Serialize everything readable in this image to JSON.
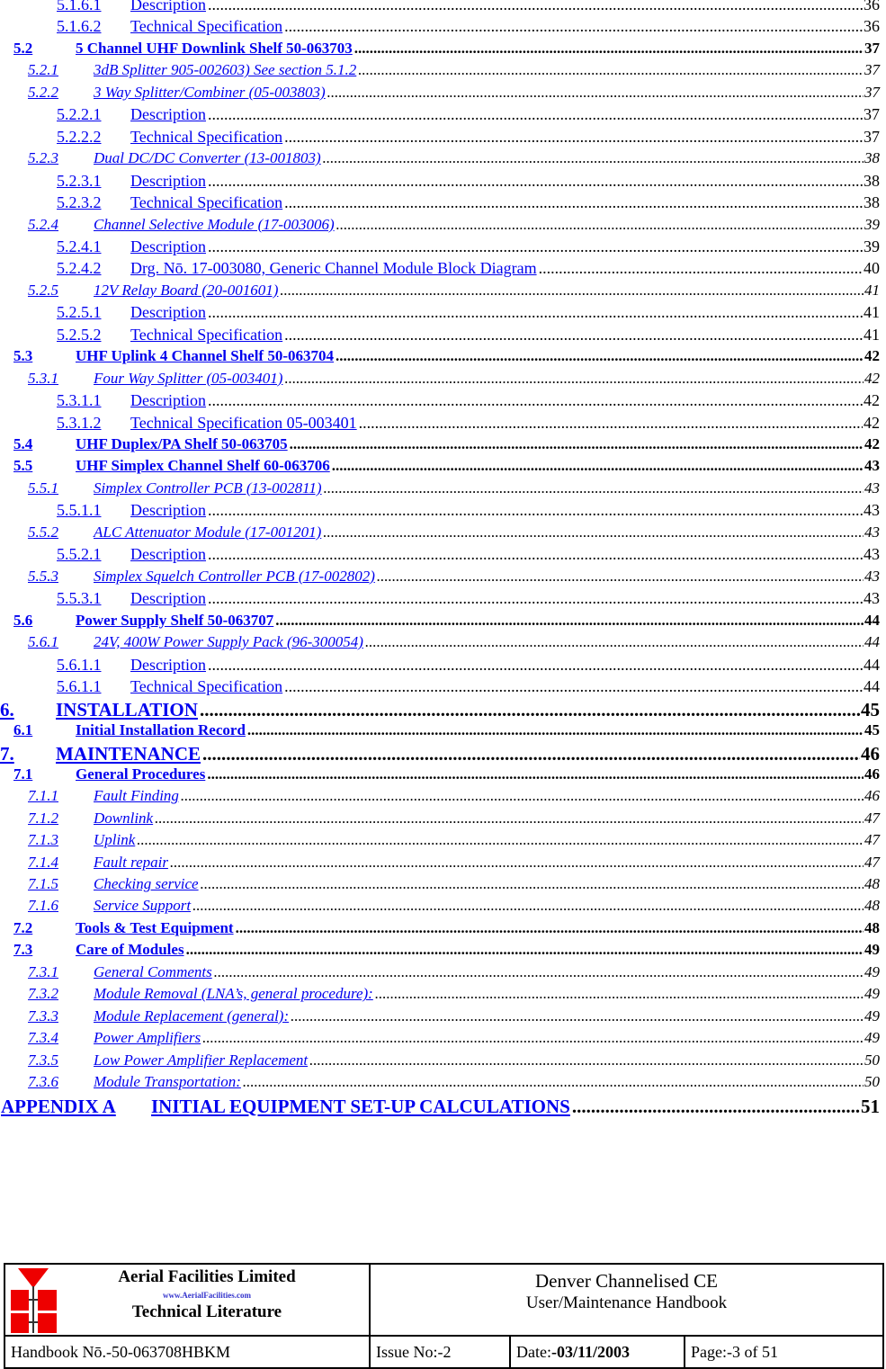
{
  "toc": [
    {
      "level": "l4",
      "num": "5.1.6.1",
      "title": "Description",
      "page": "36"
    },
    {
      "level": "l4",
      "num": "5.1.6.2",
      "title": "Technical Specification",
      "page": "36"
    },
    {
      "level": "l2",
      "num": "5.2",
      "title": "5 Channel UHF Downlink Shelf 50-063703",
      "page": "37"
    },
    {
      "level": "l3",
      "num": "5.2.1",
      "title": "3dB Splitter 905-002603) See section 5.1.2",
      "page": "37"
    },
    {
      "level": "l3",
      "num": "5.2.2",
      "title": "3 Way Splitter/Combiner (05-003803)",
      "page": "37"
    },
    {
      "level": "l4",
      "num": "5.2.2.1",
      "title": "Description",
      "page": "37"
    },
    {
      "level": "l4",
      "num": "5.2.2.2",
      "title": "Technical Specification",
      "page": "37"
    },
    {
      "level": "l3",
      "num": "5.2.3",
      "title": "Dual DC/DC Converter (13-001803)",
      "page": "38"
    },
    {
      "level": "l4",
      "num": "5.2.3.1",
      "title": "Description",
      "page": "38"
    },
    {
      "level": "l4",
      "num": "5.2.3.2",
      "title": "Technical Specification",
      "page": "38"
    },
    {
      "level": "l3",
      "num": "5.2.4",
      "title": "Channel Selective Module (17-003006)",
      "page": "39"
    },
    {
      "level": "l4",
      "num": "5.2.4.1",
      "title": "Description",
      "page": "39"
    },
    {
      "level": "l4",
      "num": "5.2.4.2",
      "title": "Drg. Nō. 17-003080, Generic Channel Module Block Diagram",
      "page": "40"
    },
    {
      "level": "l3",
      "num": "5.2.5",
      "title": "12V Relay Board (20-001601)",
      "page": "41"
    },
    {
      "level": "l4",
      "num": "5.2.5.1",
      "title": "Description",
      "page": "41"
    },
    {
      "level": "l4",
      "num": "5.2.5.2",
      "title": "Technical Specification",
      "page": "41"
    },
    {
      "level": "l2",
      "num": "5.3",
      "title": "UHF Uplink 4 Channel Shelf 50-063704",
      "page": "42"
    },
    {
      "level": "l3",
      "num": "5.3.1",
      "title": "Four Way Splitter (05-003401)",
      "page": "42"
    },
    {
      "level": "l4",
      "num": "5.3.1.1",
      "title": "Description",
      "page": "42"
    },
    {
      "level": "l4",
      "num": "5.3.1.2",
      "title": "Technical Specification 05-003401",
      "page": "42"
    },
    {
      "level": "l2",
      "num": "5.4",
      "title": "UHF Duplex/PA Shelf 50-063705",
      "page": "42"
    },
    {
      "level": "l2",
      "num": "5.5",
      "title": "UHF Simplex Channel Shelf 60-063706",
      "page": "43"
    },
    {
      "level": "l3",
      "num": "5.5.1",
      "title": "Simplex Controller PCB (13-002811)",
      "page": "43"
    },
    {
      "level": "l4",
      "num": "5.5.1.1",
      "title": "Description",
      "page": "43"
    },
    {
      "level": "l3",
      "num": "5.5.2",
      "title": "ALC Attenuator Module (17-001201)",
      "page": "43"
    },
    {
      "level": "l4",
      "num": "5.5.2.1",
      "title": "Description",
      "page": "43"
    },
    {
      "level": "l3",
      "num": "5.5.3",
      "title": "Simplex Squelch Controller PCB (17-002802)",
      "page": "43"
    },
    {
      "level": "l4",
      "num": "5.5.3.1",
      "title": "Description",
      "page": "43"
    },
    {
      "level": "l2",
      "num": "5.6",
      "title": "Power Supply Shelf 50-063707",
      "page": "44"
    },
    {
      "level": "l3",
      "num": "5.6.1",
      "title": "24V, 400W Power Supply Pack (96-300054)",
      "page": "44"
    },
    {
      "level": "l4",
      "num": "5.6.1.1",
      "title": "Description",
      "page": "44"
    },
    {
      "level": "l4",
      "num": "5.6.1.1",
      "title": "Technical Specification",
      "page": "44"
    },
    {
      "level": "l1",
      "num": "6.",
      "title": "INSTALLATION",
      "page": "45"
    },
    {
      "level": "l2",
      "num": "6.1",
      "title": "Initial Installation Record",
      "page": "45"
    },
    {
      "level": "l1",
      "num": "7.",
      "title": "MAINTENANCE",
      "page": "46"
    },
    {
      "level": "l2",
      "num": "7.1",
      "title": "General Procedures",
      "page": "46"
    },
    {
      "level": "l3",
      "num": "7.1.1",
      "title": "Fault Finding",
      "page": "46"
    },
    {
      "level": "l3",
      "num": "7.1.2",
      "title": "Downlink",
      "page": "47"
    },
    {
      "level": "l3",
      "num": "7.1.3",
      "title": "Uplink",
      "page": "47"
    },
    {
      "level": "l3",
      "num": "7.1.4",
      "title": "Fault repair",
      "page": "47"
    },
    {
      "level": "l3",
      "num": "7.1.5",
      "title": "Checking service",
      "page": "48"
    },
    {
      "level": "l3",
      "num": "7.1.6",
      "title": "Service Support",
      "page": "48"
    },
    {
      "level": "l2",
      "num": "7.2",
      "title": "Tools & Test Equipment",
      "page": "48"
    },
    {
      "level": "l2",
      "num": "7.3",
      "title": "Care of Modules",
      "page": "49"
    },
    {
      "level": "l3",
      "num": "7.3.1",
      "title": "General Comments",
      "page": "49"
    },
    {
      "level": "l3",
      "num": "7.3.2",
      "title": "Module Removal (LNA’s, general procedure):",
      "page": "49"
    },
    {
      "level": "l3",
      "num": "7.3.3",
      "title": "Module Replacement (general):",
      "page": "49"
    },
    {
      "level": "l3",
      "num": "7.3.4",
      "title": "Power Amplifiers",
      "page": "49"
    },
    {
      "level": "l3",
      "num": "7.3.5",
      "title": "Low Power Amplifier Replacement",
      "page": "50"
    },
    {
      "level": "l3",
      "num": "7.3.6",
      "title": "Module Transportation:",
      "page": "50"
    },
    {
      "level": "lA",
      "num": "APPENDIX A",
      "title": "INITIAL EQUIPMENT SET-UP CALCULATIONS",
      "page": "51"
    }
  ],
  "footer": {
    "logo": {
      "company": "Aerial  Facilities  Limited",
      "website": "www.AerialFacilities.com",
      "tagline": "Technical Literature",
      "icon": "aerial-facilities-logo-icon"
    },
    "title_line1": "Denver Channelised CE",
    "title_line2": "User/Maintenance Handbook",
    "handbook": "Handbook Nō.-50-063708HBKM",
    "issue": "Issue No:-2",
    "date_label": "Date:",
    "date_value": "-03/11/2003",
    "page_label": "Page:",
    "page_value": "-3 of 51"
  },
  "colors": {
    "link": "#0000ee",
    "logo_red": "#ee0000",
    "website_blue": "#3333cc"
  }
}
